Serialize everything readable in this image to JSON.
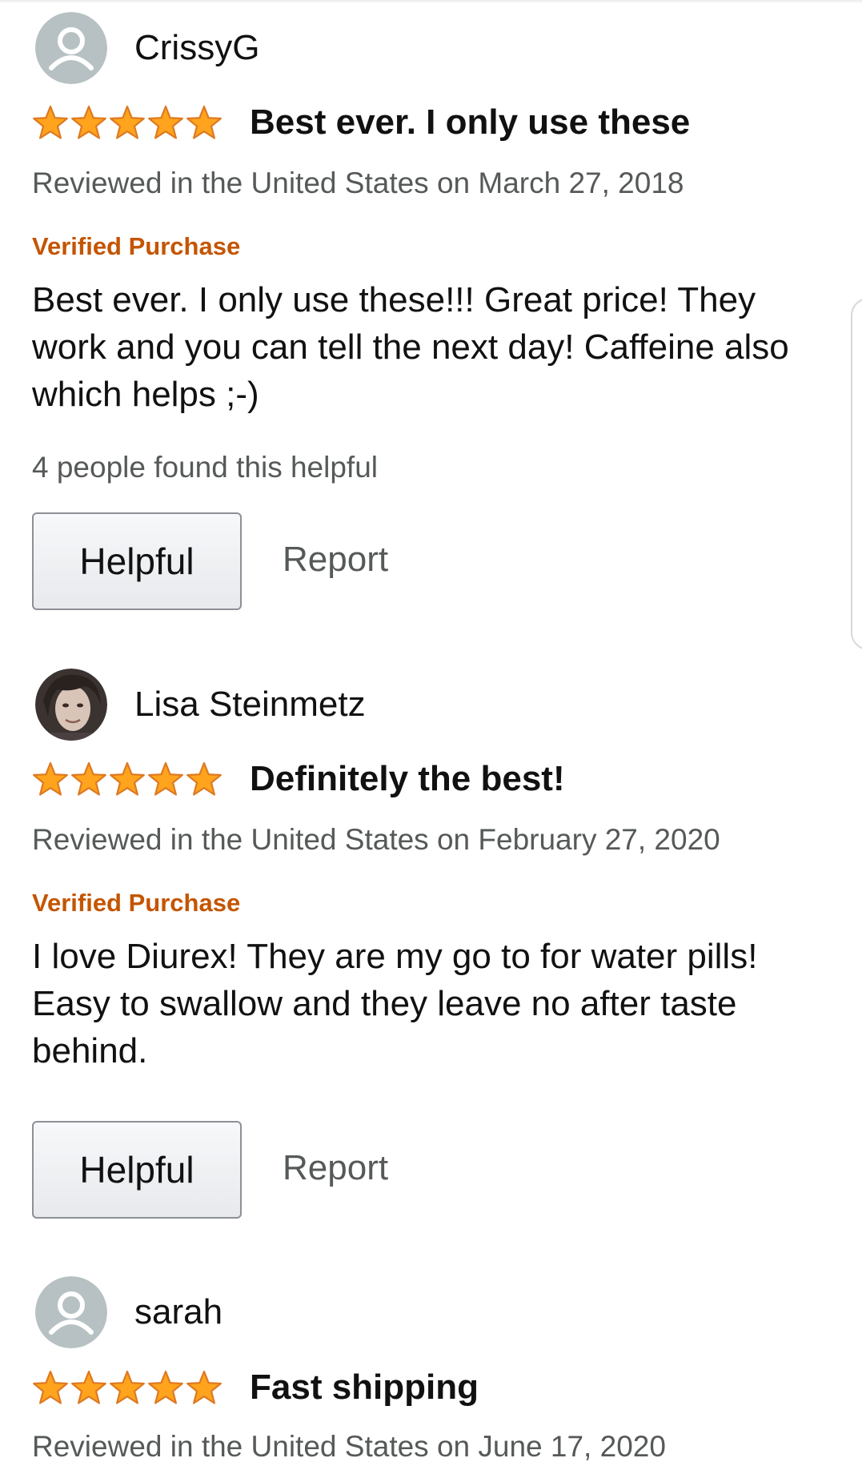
{
  "reviews": [
    {
      "reviewer": "CrissyG",
      "avatar_icon": "default-profile-icon",
      "rating": 5,
      "title": "Best ever. I only use these",
      "meta": "Reviewed in the United States on March 27, 2018",
      "verified": "Verified Purchase",
      "body_lines": [
        "Best ever. I only use these!!! Great price! They",
        "work and you can tell the next day! Caffeine also",
        "which helps ;-)"
      ],
      "helpful_count": "4 people found this helpful",
      "helpful_label": "Helpful",
      "report_label": "Report"
    },
    {
      "reviewer": "Lisa Steinmetz",
      "avatar_icon": "user-photo",
      "rating": 5,
      "title": "Definitely the best!",
      "meta": "Reviewed in the United States on February 27, 2020",
      "verified": "Verified Purchase",
      "body_lines": [
        "I love Diurex! They are my go to for water pills!",
        "Easy to swallow and they leave no after taste",
        "behind."
      ],
      "helpful_label": "Helpful",
      "report_label": "Report"
    },
    {
      "reviewer": "sarah",
      "avatar_icon": "default-profile-icon",
      "rating": 5,
      "title": "Fast shipping",
      "meta": "Reviewed in the United States on June 17, 2020"
    }
  ],
  "colors": {
    "star": "#ffa41c",
    "star_outline": "#de7921",
    "verified": "#c45500",
    "meta_text": "#565959",
    "avatar_bg": "#b7c1c4"
  }
}
